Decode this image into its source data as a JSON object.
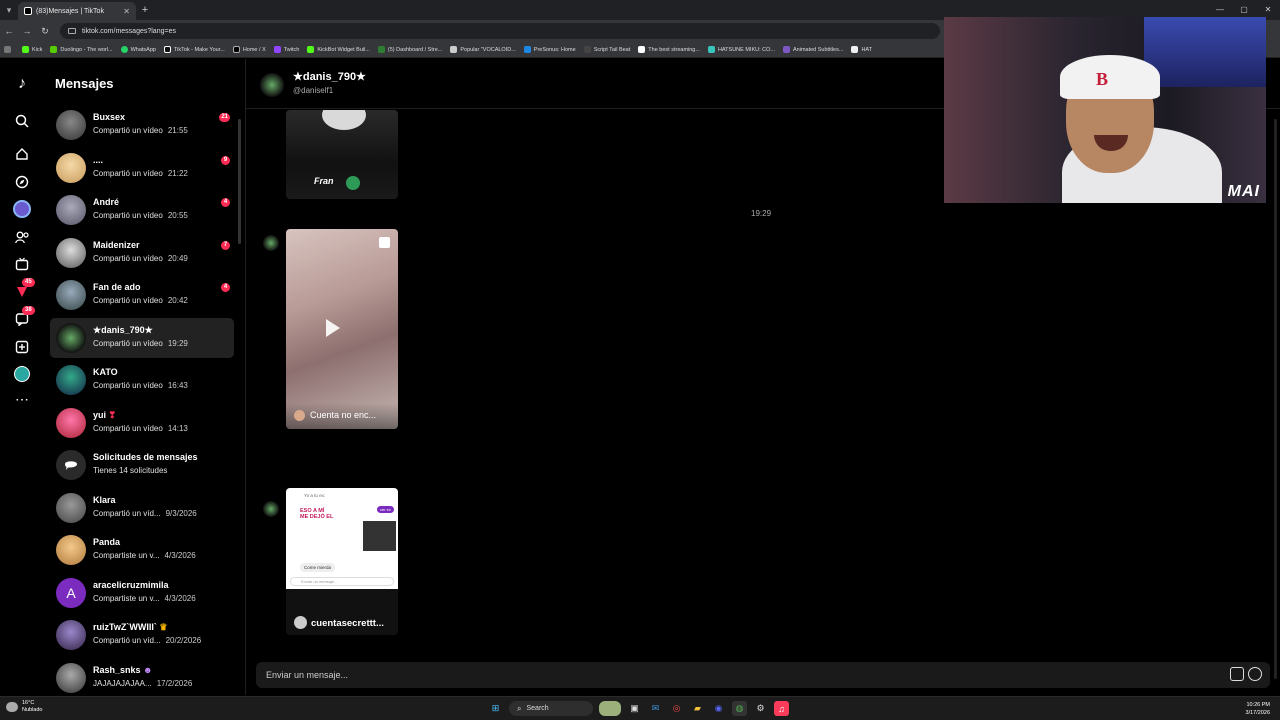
{
  "browser": {
    "tab_title": "(83)Mensajes | TikTok",
    "url": "tiktok.com/messages?lang=es",
    "bookmarks": [
      "Kick",
      "Duolingo - The worl...",
      "WhatsApp",
      "TikTok - Make Your...",
      "Home / X",
      "Twitch",
      "KickBot Widget Buil...",
      "(5) Dashboard / Stre...",
      "Popular \"VOCALOID...",
      "PreSonus: Home",
      "Script Tail Beat",
      "The best streaming...",
      "HATSUNE MIKU: CO...",
      "Animated Subtitles...",
      "HAT"
    ]
  },
  "rail": {
    "friends_badge": "45",
    "inbox_badge": "38"
  },
  "sidebar": {
    "title": "Mensajes",
    "conversations": [
      {
        "name": "Buxsex",
        "preview": "Compartió un vídeo",
        "time": "21:55",
        "unread": "21"
      },
      {
        "name": "....",
        "preview": "Compartió un vídeo",
        "time": "21:22",
        "unread": "9"
      },
      {
        "name": "André",
        "preview": "Compartió un vídeo",
        "time": "20:55",
        "unread": "4"
      },
      {
        "name": "Maidenizer",
        "preview": "Compartió un vídeo",
        "time": "20:49",
        "unread": "7"
      },
      {
        "name": "Fan de ado",
        "preview": "Compartió un vídeo",
        "time": "20:42",
        "unread": "4"
      },
      {
        "name": "★danis_790★",
        "preview": "Compartió un vídeo",
        "time": "19:29",
        "unread": ""
      },
      {
        "name": "KATO",
        "preview": "Compartió un vídeo",
        "time": "16:43",
        "unread": ""
      },
      {
        "name": "yui",
        "preview": "Compartió un vídeo",
        "time": "14:13",
        "unread": ""
      },
      {
        "name": "Solicitudes de mensajes",
        "preview": "Tienes 14 solicitudes",
        "time": "",
        "unread": ""
      },
      {
        "name": "Klara",
        "preview": "Compartió un víd...",
        "time": "9/3/2026",
        "unread": ""
      },
      {
        "name": "Panda",
        "preview": "Compartiste un v...",
        "time": "4/3/2026",
        "unread": ""
      },
      {
        "name": "aracelicruzmimila",
        "preview": "Compartiste un v...",
        "time": "4/3/2026",
        "unread": ""
      },
      {
        "name": "ruizTwZ`WWIII`",
        "preview": "Compartió un víd...",
        "time": "20/2/2026",
        "unread": ""
      },
      {
        "name": "Rash_snks",
        "preview": "JAJAJAJAJAA...",
        "time": "17/2/2026",
        "unread": ""
      }
    ]
  },
  "chat": {
    "name": "★danis_790★",
    "handle": "@daniself1",
    "timestamp": "19:29",
    "video_caption": "Cuenta no enc...",
    "card2": {
      "top_text": "Yo a tu ex:",
      "headline": "ESO A MÍ ME DEJÓ EL",
      "pill": "ver ex",
      "bubble": "Come mierda",
      "input_hint": "Enviar un mensaje...",
      "account": "cuentasecrettt..."
    },
    "first_card_caption": "Fran",
    "input_placeholder": "Enviar un mensaje..."
  },
  "webcam": {
    "tag": "MAI"
  },
  "taskbar": {
    "temp": "16°C",
    "weather": "Nublado",
    "search": "Search",
    "time": "10:26 PM",
    "date": "3/17/2026"
  }
}
